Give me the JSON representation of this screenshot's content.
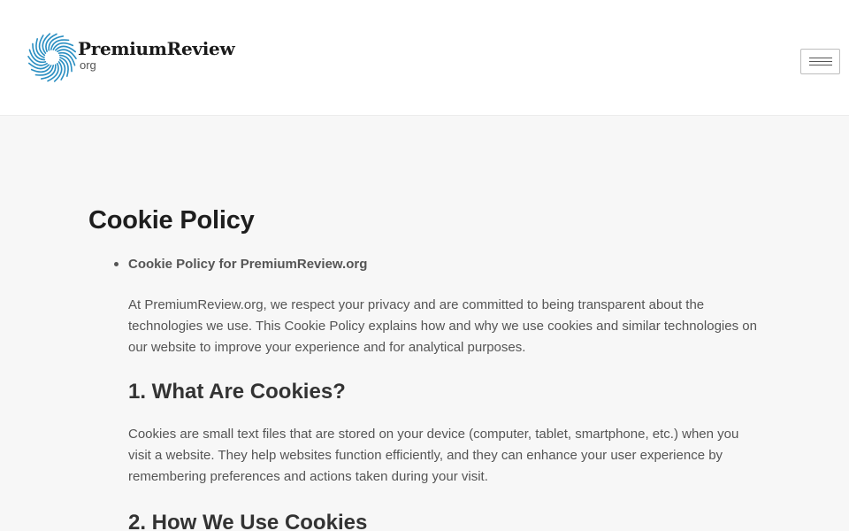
{
  "header": {
    "logo_name": "PremiumReview",
    "logo_tld": "org"
  },
  "content": {
    "title": "Cookie Policy",
    "item_heading": "Cookie Policy for PremiumReview.org",
    "intro": "At PremiumReview.org, we respect your privacy and are committed to being transparent about the technologies we use. This Cookie Policy explains how and why we use cookies and similar technologies on our website to improve your experience and for analytical purposes.",
    "section_1_title": "1. What Are Cookies?",
    "section_1_text": "Cookies are small text files that are stored on your device (computer, tablet, smartphone, etc.) when you visit a website. They help websites function efficiently, and they can enhance your user experience by remembering preferences and actions taken during your visit.",
    "section_2_title": "2. How We Use Cookies"
  },
  "icons": {
    "logo": "spiral-logo-icon",
    "menu": "hamburger-icon"
  },
  "colors": {
    "logo_blue": "#2b8fc2",
    "background": "#f7f7f7"
  }
}
